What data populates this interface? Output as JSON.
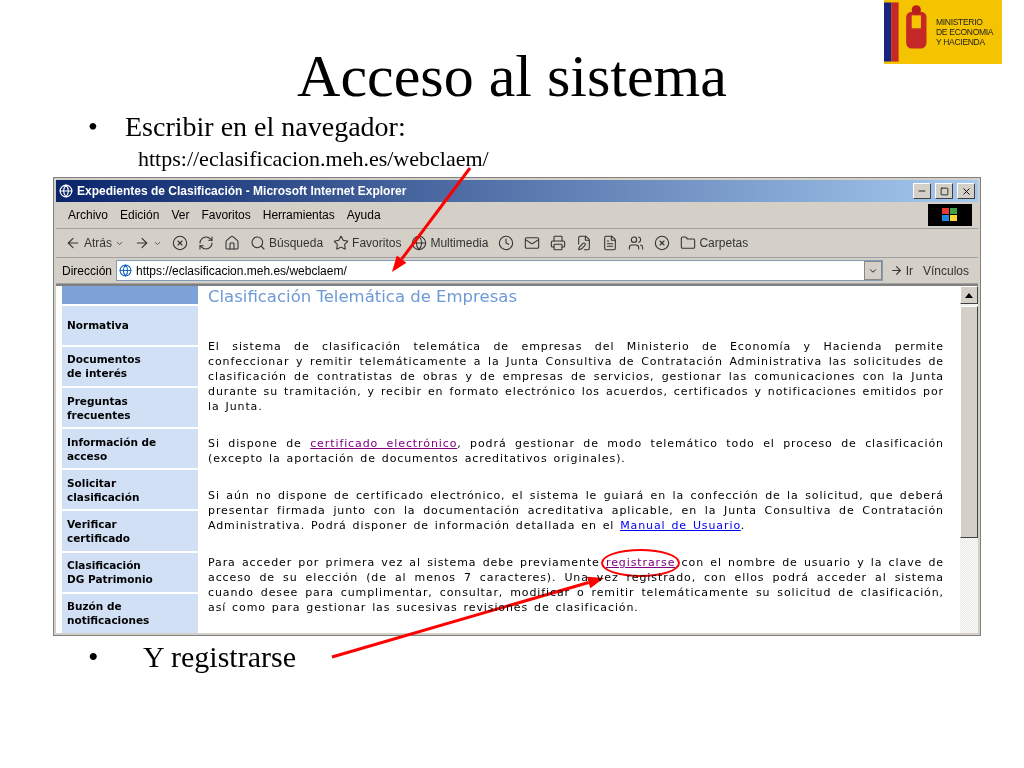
{
  "slide": {
    "title": "Acceso al sistema",
    "logo_lines": [
      "MINISTERIO",
      "DE ECONOMIA",
      "Y HACIENDA"
    ],
    "bullet": {
      "marker": "•",
      "text": "Escribir en el navegador:"
    },
    "url_line": "https://eclasificacion.meh.es/webclaem/",
    "final_bullet": {
      "marker": "•",
      "text": "Y registrarse"
    }
  },
  "browser": {
    "title": "Expedientes de Clasificación - Microsoft Internet Explorer",
    "menu": [
      "Archivo",
      "Edición",
      "Ver",
      "Favoritos",
      "Herramientas",
      "Ayuda"
    ],
    "toolbar": [
      {
        "kind": "back",
        "label": "Atrás"
      },
      {
        "kind": "forward"
      },
      {
        "kind": "stop"
      },
      {
        "kind": "refresh"
      },
      {
        "kind": "home"
      },
      {
        "kind": "search",
        "label": "Búsqueda"
      },
      {
        "kind": "favorites",
        "label": "Favoritos"
      },
      {
        "kind": "media",
        "label": "Multimedia"
      },
      {
        "kind": "history"
      },
      {
        "kind": "mail"
      },
      {
        "kind": "print"
      },
      {
        "kind": "edit"
      },
      {
        "kind": "discuss"
      },
      {
        "kind": "messenger"
      },
      {
        "kind": "close"
      },
      {
        "kind": "folders",
        "label": "Carpetas"
      }
    ],
    "address": {
      "label": "Dirección",
      "value": "https://eclasificacion.meh.es/webclaem/",
      "go": "Ir",
      "links": "Vínculos"
    },
    "page": {
      "sidebar": [
        "Normativa",
        "Documentos\nde interés",
        "Preguntas\nfrecuentes",
        "Información de\nacceso",
        "Solicitar\nclasificación",
        "Verificar\ncertificado",
        "Clasificación\nDG Patrimonio",
        "Buzón de\nnotificaciones"
      ],
      "heading": "Clasificación Telemática de Empresas",
      "paragraphs": [
        [
          {
            "text": "El sistema de clasificación telemática de empresas del Ministerio de Economía y Hacienda permite confeccionar y remitir telemáticamente a la Junta Consultiva de Contratación Administrativa las solicitudes de clasificación de contratistas de obras y de empresas de servicios, gestionar las comunicaciones con la Junta durante su tramitación, y recibir en formato electrónico los acuerdos, certificados y notificaciones emitidos por la Junta."
          }
        ],
        [
          {
            "text": "Si dispone de "
          },
          {
            "link": "certificado electrónico",
            "visited": true
          },
          {
            "text": ", podrá gestionar de modo telemático todo el proceso de clasificación (excepto la aportación de documentos acreditativos originales)."
          }
        ],
        [
          {
            "text": "Si aún no dispone de certificado electrónico, el sistema le guiará en la confección de la solicitud, que deberá presentar firmada junto con la documentación acreditativa aplicable, en la Junta Consultiva de Contratación Administrativa. Podrá disponer de información detallada en el "
          },
          {
            "link": "Manual de Usuario",
            "visited": false
          },
          {
            "text": "."
          }
        ],
        [
          {
            "text": "Para acceder por primera vez al sistema debe previamente "
          },
          {
            "link": "registrarse",
            "visited": true,
            "circled": true
          },
          {
            "text": " con el nombre de usuario y la clave de acceso de su elección (de al menos 7 caracteres). Una vez registrado, con ellos podrá acceder al sistema cuando desee para cumplimentar, consultar, modificar o remitir telemáticamente su solicitud de clasificación, así como para gestionar las sucesivas revisiones de clasificación."
          }
        ]
      ]
    }
  }
}
